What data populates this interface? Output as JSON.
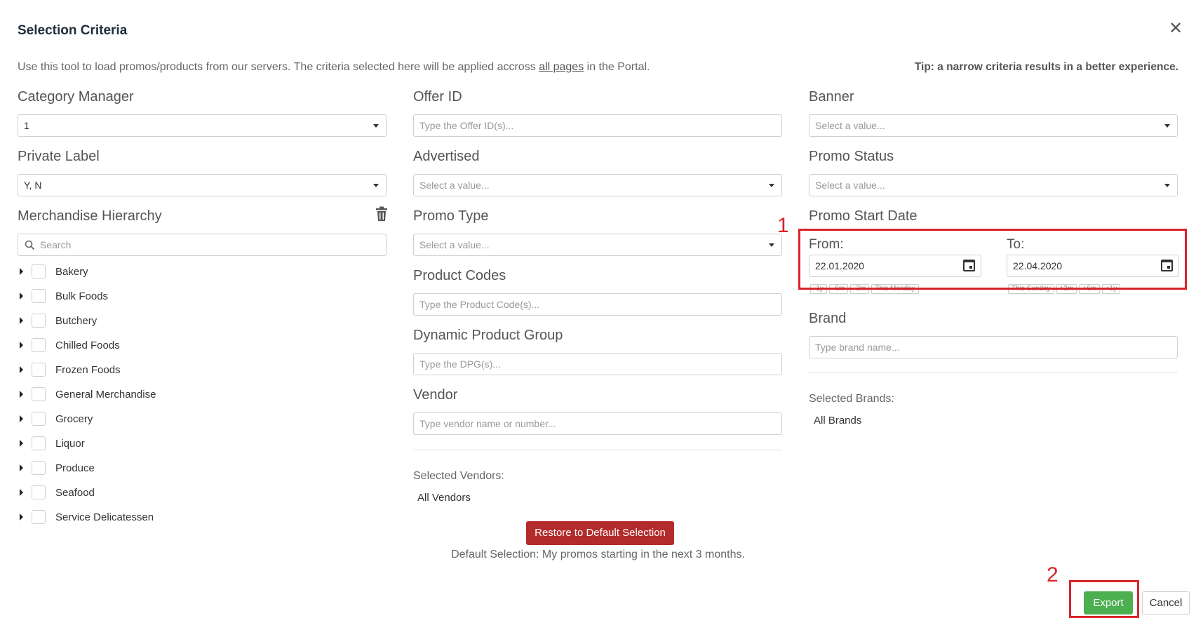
{
  "dialog": {
    "title": "Selection Criteria",
    "intro_before": "Use this tool to load promos/products from our servers. The criteria selected here will be applied accross ",
    "intro_link": "all pages",
    "intro_after": " in the Portal.",
    "tip": "Tip: a narrow criteria results in a better experience."
  },
  "left": {
    "category_manager": {
      "label": "Category Manager",
      "value": "1"
    },
    "private_label": {
      "label": "Private Label",
      "value": "Y, N"
    },
    "hierarchy": {
      "label": "Merchandise Hierarchy",
      "search_placeholder": "Search",
      "items": [
        "Bakery",
        "Bulk Foods",
        "Butchery",
        "Chilled Foods",
        "Frozen Foods",
        "General Merchandise",
        "Grocery",
        "Liquor",
        "Produce",
        "Seafood",
        "Service Delicatessen"
      ]
    }
  },
  "middle": {
    "offer_id": {
      "label": "Offer ID",
      "placeholder": "Type the Offer ID(s)..."
    },
    "advertised": {
      "label": "Advertised",
      "value": "Select a value..."
    },
    "promo_type": {
      "label": "Promo Type",
      "value": "Select a value..."
    },
    "product_codes": {
      "label": "Product Codes",
      "placeholder": "Type the Product Code(s)..."
    },
    "dpg": {
      "label": "Dynamic Product Group",
      "placeholder": "Type the DPG(s)..."
    },
    "vendor": {
      "label": "Vendor",
      "placeholder": "Type vendor name or number..."
    },
    "selected_vendors_label": "Selected Vendors:",
    "selected_vendors_value": "All Vendors"
  },
  "right": {
    "banner": {
      "label": "Banner",
      "value": "Select a value..."
    },
    "promo_status": {
      "label": "Promo Status",
      "value": "Select a value..."
    },
    "promo_start_date": {
      "label": "Promo Start Date",
      "from_label": "From:",
      "from_value": "22.01.2020",
      "from_chips": [
        "-1y",
        "-6m",
        "-3m",
        "This Monday"
      ],
      "to_label": "To:",
      "to_value": "22.04.2020",
      "to_chips": [
        "This Sunday",
        "+3m",
        "+6m",
        "+1y"
      ]
    },
    "brand": {
      "label": "Brand",
      "placeholder": "Type brand name..."
    },
    "selected_brands_label": "Selected Brands:",
    "selected_brands_value": "All Brands"
  },
  "footer": {
    "restore_label": "Restore to Default Selection",
    "default_note": "Default Selection: My promos starting in the next 3 months.",
    "export_label": "Export",
    "cancel_label": "Cancel"
  },
  "annotations": {
    "marker_1": "1",
    "marker_2": "2"
  },
  "colors": {
    "restore": "#b42b2b",
    "export": "#4caf50",
    "highlight": "#d8232a"
  }
}
